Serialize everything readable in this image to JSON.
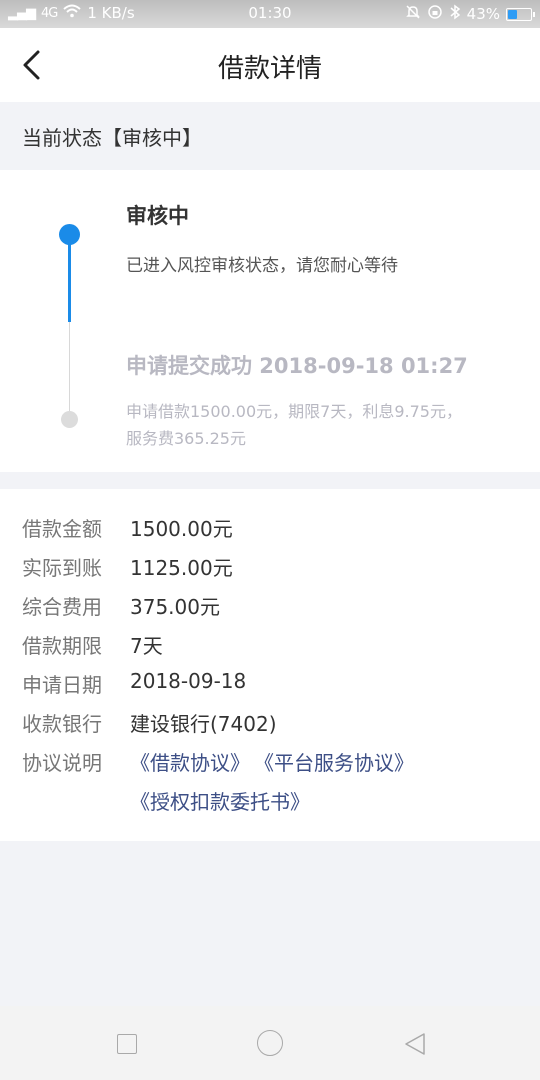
{
  "status_bar": {
    "network": "4G",
    "speed": "1 KB/s",
    "time": "01:30",
    "battery": "43%",
    "battery_level": 0.43,
    "battery_color": "#2e9cf5"
  },
  "header": {
    "title": "借款详情",
    "back_icon": "chevron-left-icon"
  },
  "current_state": {
    "text": "当前状态【审核中】"
  },
  "timeline": {
    "accent_color": "#1a8be8",
    "steps": [
      {
        "title": "审核中",
        "desc": "已进入风控审核状态，请您耐心等待"
      },
      {
        "title": "申请提交成功 2018-09-18 01:27",
        "desc": "申请借款1500.00元，期限7天，利息9.75元，服务费365.25元"
      }
    ]
  },
  "details": {
    "rows": [
      {
        "label": "借款金额",
        "value": "1500.00元"
      },
      {
        "label": "实际到账",
        "value": "1125.00元"
      },
      {
        "label": "综合费用",
        "value": "375.00元"
      },
      {
        "label": "借款期限",
        "value": "7天"
      },
      {
        "label": "申请日期",
        "value": "2018-09-18"
      },
      {
        "label": "收款银行",
        "value": "建设银行(7402)"
      }
    ],
    "agreements_label": "协议说明",
    "agreements": [
      "《借款协议》",
      "《平台服务协议》",
      "《授权扣款委托书》"
    ]
  },
  "system_nav": {
    "keys": [
      "recent-apps-icon",
      "home-icon",
      "back-triangle-icon"
    ]
  }
}
